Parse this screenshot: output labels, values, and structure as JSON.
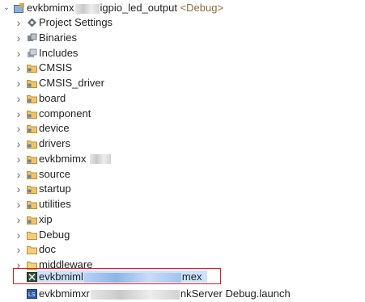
{
  "project": {
    "name_prefix": "evkbmimx",
    "name_suffix": "igpio_led_output",
    "config": "<Debug>"
  },
  "items": [
    {
      "label": "Project Settings",
      "icon": "settings-icon"
    },
    {
      "label": "Binaries",
      "icon": "binaries-icon"
    },
    {
      "label": "Includes",
      "icon": "includes-icon"
    },
    {
      "label": "CMSIS",
      "icon": "source-folder-icon"
    },
    {
      "label": "CMSIS_driver",
      "icon": "source-folder-icon"
    },
    {
      "label": "board",
      "icon": "source-folder-icon"
    },
    {
      "label": "component",
      "icon": "source-folder-icon"
    },
    {
      "label": "device",
      "icon": "source-folder-icon"
    },
    {
      "label": "drivers",
      "icon": "source-folder-icon"
    },
    {
      "label": "evkbmimx",
      "icon": "source-folder-icon"
    },
    {
      "label": "source",
      "icon": "source-folder-icon"
    },
    {
      "label": "startup",
      "icon": "source-folder-icon"
    },
    {
      "label": "utilities",
      "icon": "source-folder-icon"
    },
    {
      "label": "xip",
      "icon": "source-folder-icon"
    },
    {
      "label": "Debug",
      "icon": "folder-icon"
    },
    {
      "label": "doc",
      "icon": "folder-icon"
    },
    {
      "label": "middleware",
      "icon": "folder-icon"
    }
  ],
  "files": [
    {
      "prefix": "evkbmiml",
      "suffix": "mex",
      "icon": "mex-file-icon",
      "selected": true
    },
    {
      "prefix": "evkbmimxr",
      "suffix": "nkServer Debug.launch",
      "icon": "launch-file-icon",
      "selected": false
    }
  ],
  "colors": {
    "selection_border": "#d92020",
    "selection_fill": "#cce3fb",
    "folder": "#e8b44c"
  }
}
